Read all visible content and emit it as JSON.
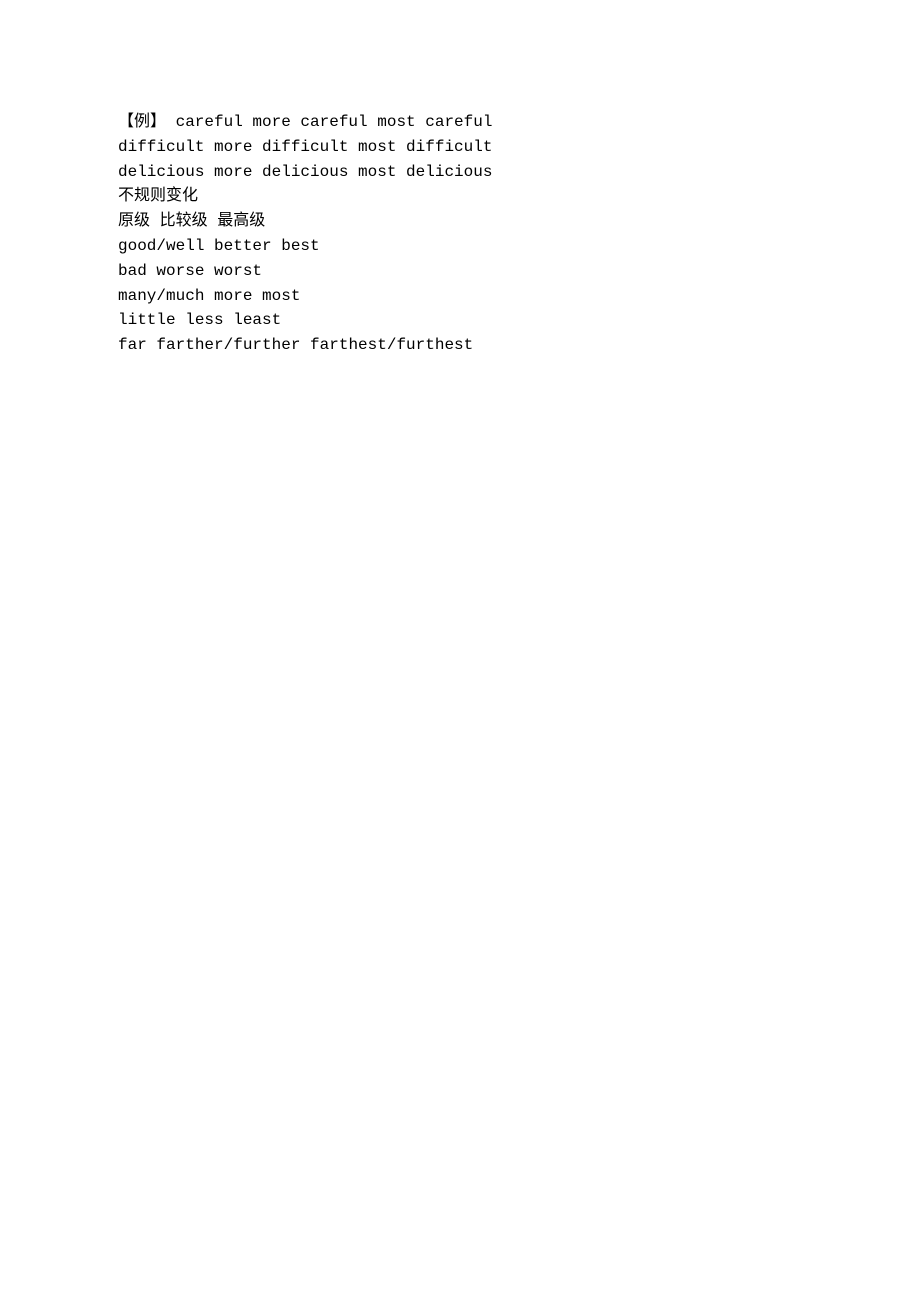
{
  "lines": [
    "【例】 careful more careful most careful",
    "difficult more difficult most difficult",
    "delicious more delicious most delicious",
    "不规则变化",
    "原级 比较级 最高级",
    "good/well better best",
    "bad worse worst",
    "many/much more most",
    "little less least",
    "far farther/further farthest/furthest"
  ]
}
